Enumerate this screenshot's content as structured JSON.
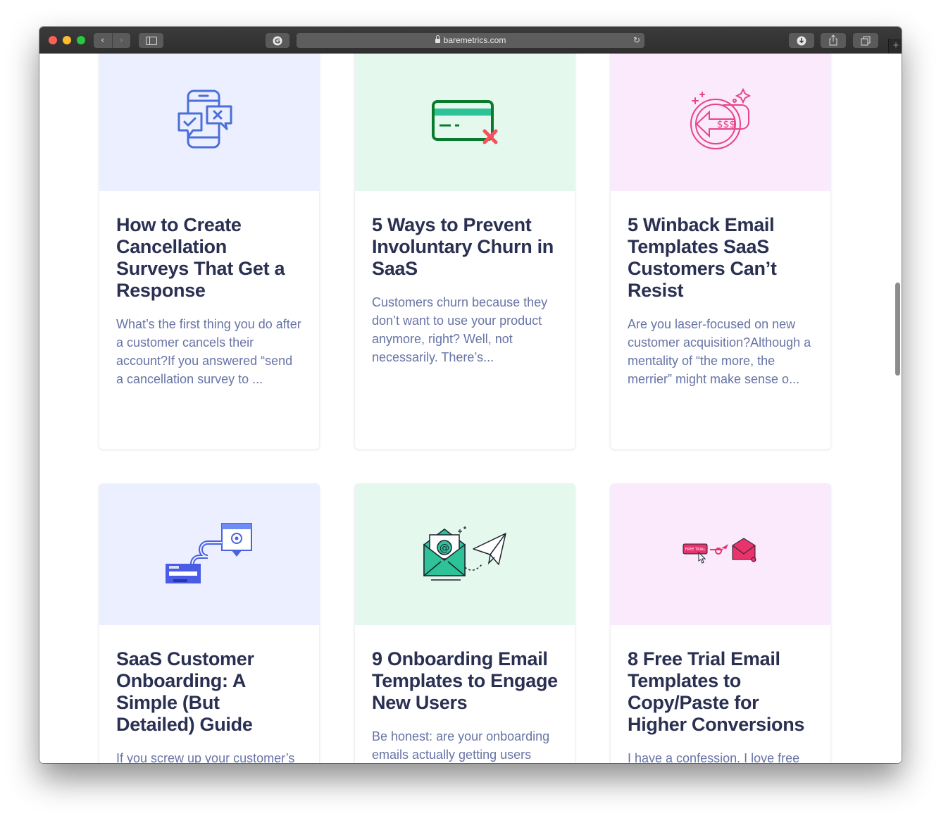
{
  "browser": {
    "url": "baremetrics.com",
    "back_icon": "chevron-left-icon",
    "forward_icon": "chevron-right-icon"
  },
  "colors": {
    "blue_bg": "#ebefff",
    "green_bg": "#e5f8ee",
    "pink_bg": "#fbe9fc",
    "title": "#2a3052",
    "excerpt": "#6774a6"
  },
  "cards": [
    {
      "icon": "chat-phone-icon",
      "title": "How to Create Cancellation Surveys That Get a Response",
      "excerpt": "What’s the first thing you do after a customer cancels their account?If you answered “send a cancellation survey to ..."
    },
    {
      "icon": "declined-card-icon",
      "title": "5 Ways to Prevent Involuntary Churn in SaaS",
      "excerpt": "Customers churn because they don’t want to use your product anymore, right? Well, not necessarily. There’s..."
    },
    {
      "icon": "winback-coin-icon",
      "title": "5 Winback Email Templates SaaS Customers Can’t Resist",
      "excerpt": "Are you laser-focused on new customer acquisition?Although a mentality of “the more, the merrier” might make sense o..."
    },
    {
      "icon": "onboarding-flow-icon",
      "title": "SaaS Customer Onboarding: A Simple (But Detailed) Guide",
      "excerpt": "If you screw up your customer’s experience early on in their relationship, it’s hard to ..."
    },
    {
      "icon": "email-paper-plane-icon",
      "title": "9 Onboarding Email Templates to Engage New Users",
      "excerpt": "Be honest: are your onboarding emails actually getting users excited about your product?The onboarding process is obviou..."
    },
    {
      "icon": "free-trial-email-icon",
      "title": "8 Free Trial Email Templates to Copy/Paste for Higher Conversions",
      "excerpt": "I have a confession. I love free trials. I sign up for free trials of software like it’s my job. I f...",
      "badge": "FREE TRIAL"
    }
  ]
}
